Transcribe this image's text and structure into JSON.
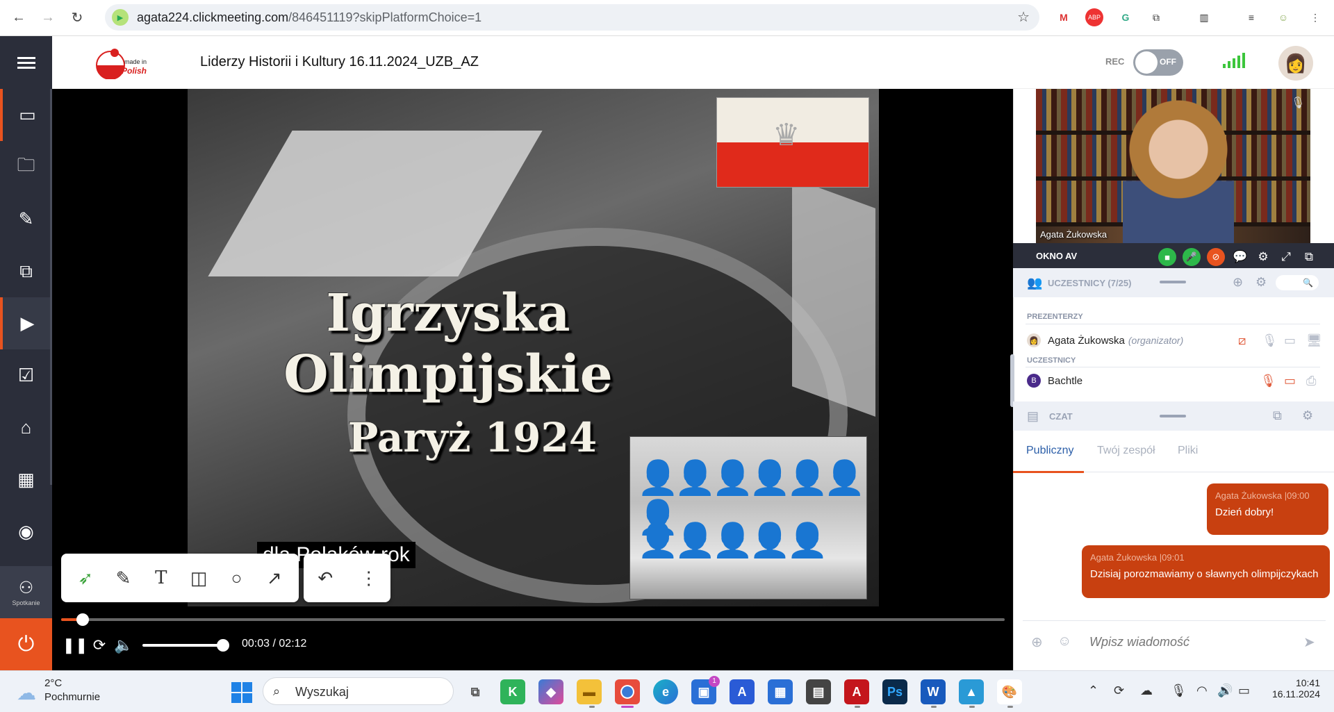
{
  "browser": {
    "url_host": "agata224.clickmeeting.com",
    "url_path": "/846451119?skipPlatformChoice=1",
    "extensions": [
      "gmail-icon",
      "adblock-icon",
      "google-icon",
      "puzzle-icon",
      "reading-list-icon",
      "media-icon",
      "profile-icon"
    ]
  },
  "app": {
    "title": "Liderzy Historii i Kultury 16.11.2024_UZB_AZ",
    "logo_text": "made in Polish",
    "rec_label": "REC",
    "rec_state": "OFF",
    "accent": "#e8531f"
  },
  "sidebar": {
    "items": [
      {
        "name": "camera"
      },
      {
        "name": "folder"
      },
      {
        "name": "edit"
      },
      {
        "name": "screen-share"
      },
      {
        "name": "video-player"
      },
      {
        "name": "poll"
      },
      {
        "name": "whiteboard"
      },
      {
        "name": "apps"
      },
      {
        "name": "broadcast"
      }
    ],
    "meeting_label": "Spotkanie"
  },
  "video": {
    "title_line1": "Igrzyska",
    "title_line2": "Olimpijskie",
    "title_line3": "Paryż 1924",
    "subtitle": "dla Polaków rok",
    "current_time": "00:03",
    "total_time": "02:12",
    "progress": 0.023,
    "volume": 1.0
  },
  "drawing_tools": [
    "pointer",
    "pencil",
    "text",
    "sticky-note",
    "circle",
    "arrow",
    "undo",
    "more"
  ],
  "camera": {
    "presenter_name": "Agata Żukowska",
    "window_label": "OKNO AV"
  },
  "participants": {
    "header": "UCZESTNICY (7/25)",
    "presenters_label": "PREZENTERZY",
    "participants_label": "UCZESTNICY",
    "presenters": [
      {
        "name": "Agata Żukowska",
        "role": "(organizator)"
      }
    ],
    "attendees": [
      {
        "name": "Bachtle",
        "initial": "B"
      }
    ]
  },
  "chat": {
    "header": "CZAT",
    "tabs": [
      "Publiczny",
      "Twój zespół",
      "Pliki"
    ],
    "messages": [
      {
        "author": "Agata Żukowska",
        "time": "09:00",
        "text": "Dzień dobry!"
      },
      {
        "author": "Agata Żukowska",
        "time": "09:01",
        "text": "Dzisiaj porozmawiamy o sławnych olimpijczykach"
      }
    ],
    "input_placeholder": "Wpisz wiadomość"
  },
  "taskbar": {
    "temperature": "2°C",
    "condition": "Pochmurnie",
    "search_placeholder": "Wyszukaj",
    "store_badge": "1",
    "time": "10:41",
    "date": "16.11.2024"
  }
}
